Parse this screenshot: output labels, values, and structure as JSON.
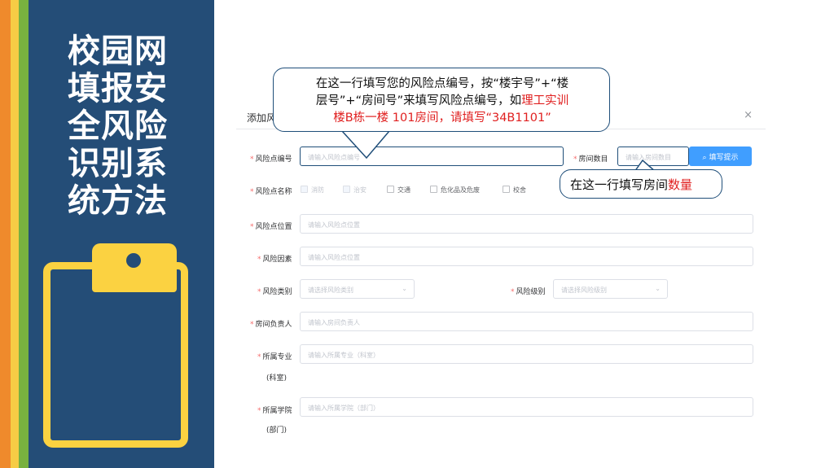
{
  "sidebar": {
    "title_lines": [
      "校园网",
      "填报安",
      "全风险",
      "识别系",
      "统方法"
    ],
    "clipboard_icon": "clipboard-icon"
  },
  "dialog": {
    "title": "添加风",
    "close": "×",
    "risk_point_code": {
      "label": "风险点编号",
      "placeholder": "请输入风险点编号"
    },
    "room_count": {
      "label": "房间数目",
      "placeholder": "请输入房间数目"
    },
    "fill_hint_button": "填写提示",
    "risk_point_name": {
      "label": "风险点名称",
      "options": [
        {
          "label": "消防",
          "checked": true
        },
        {
          "label": "治安",
          "checked": true
        },
        {
          "label": "交通",
          "checked": false
        },
        {
          "label": "危化品及危废",
          "checked": false
        },
        {
          "label": "校舍",
          "checked": false
        }
      ]
    },
    "risk_point_location": {
      "label": "风险点位置",
      "placeholder": "请输入风险点位置"
    },
    "risk_factor": {
      "label": "风险因素",
      "placeholder": "请输入风险点位置"
    },
    "risk_category": {
      "label": "风险类别",
      "placeholder": "请选择风险类别"
    },
    "risk_level": {
      "label": "风险级别",
      "placeholder": "请选择风险级别"
    },
    "room_owner": {
      "label": "房间负责人",
      "placeholder": "请输入房间负责人"
    },
    "major": {
      "label": "所属专业",
      "label2": "(科室)",
      "placeholder": "请输入所属专业（科室）"
    },
    "college": {
      "label": "所属学院",
      "label2": "(部门)",
      "placeholder": "请输入所属学院（部门）"
    }
  },
  "callout_code": {
    "line1": "在这一行填写您的风险点编号，按“楼宇号”+“楼",
    "line2_black": "层号”+“房间号”来填写风险点编号，如",
    "line2_red": "理工实训",
    "line3_red": "楼B栋一楼  101房间，请填写“34B1101”"
  },
  "callout_room": {
    "text_black": "在这一行填写房间",
    "text_red": "数量"
  },
  "colors": {
    "accent_blue": "#409eff",
    "sidebar": "#244d77",
    "highlight_red": "#e02020",
    "clipboard": "#fbd241"
  }
}
